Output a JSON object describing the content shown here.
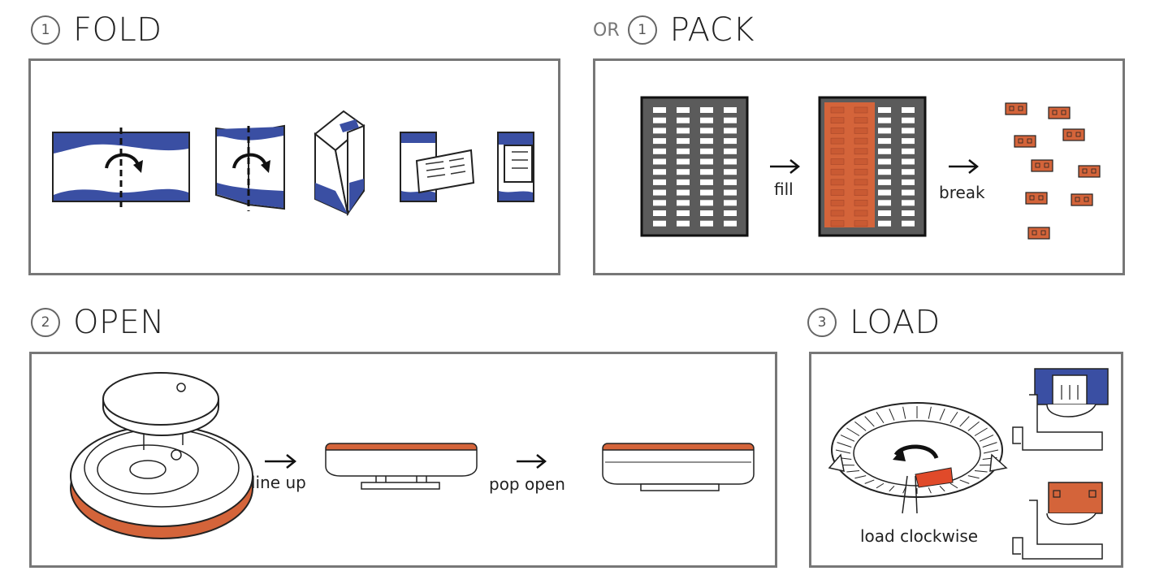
{
  "sections": {
    "fold": {
      "number": "1",
      "title": "FOLD"
    },
    "pack": {
      "prefix": "OR",
      "number": "1",
      "title": "PACK",
      "fill_label": "fill",
      "break_label": "break"
    },
    "open": {
      "number": "2",
      "title": "OPEN",
      "lineup_label": "line up",
      "popopen_label": "pop open"
    },
    "load": {
      "number": "3",
      "title": "LOAD",
      "load_label": "load clockwise"
    }
  },
  "colors": {
    "blue": "#3a4fa3",
    "orange": "#d4643a",
    "grid": "#5b5b5b",
    "border": "#777777"
  }
}
